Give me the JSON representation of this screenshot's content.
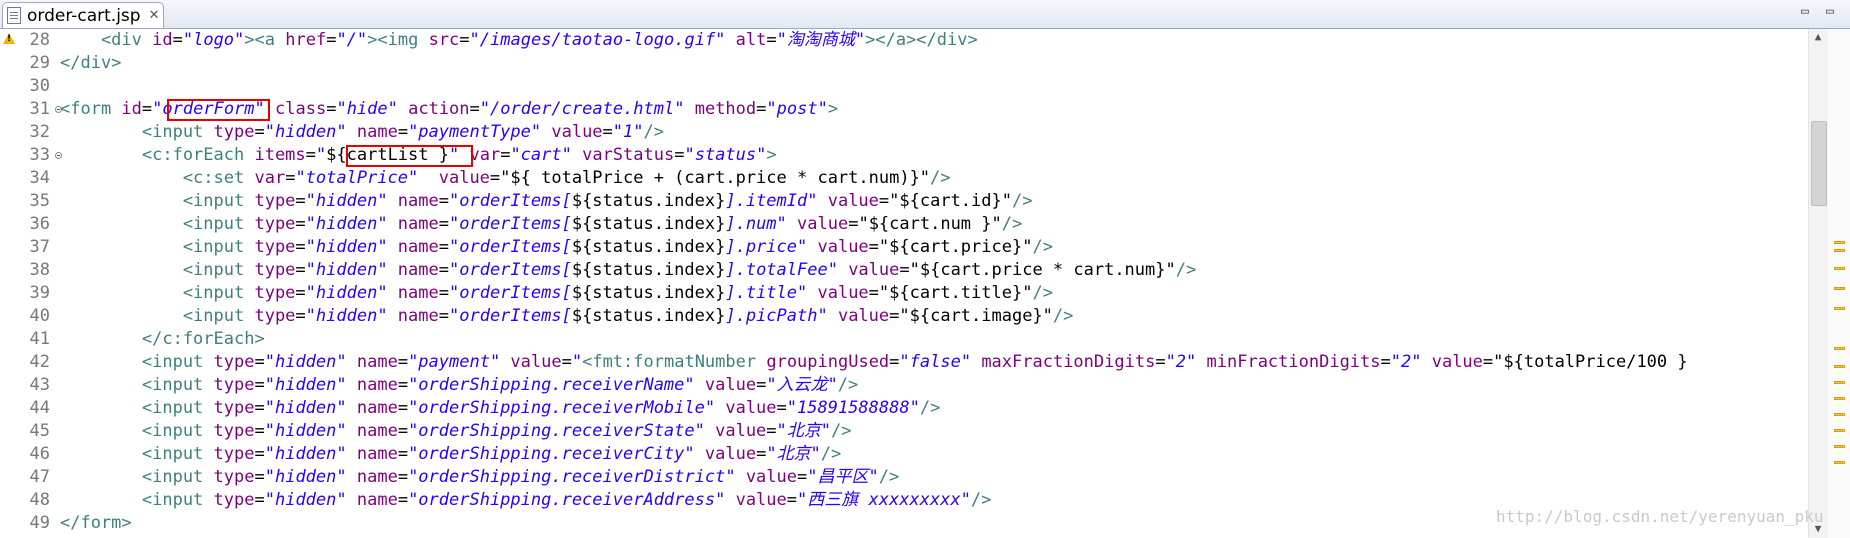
{
  "tab": {
    "filename": "order-cart.jsp",
    "close_glyph": "✕"
  },
  "window_controls": {
    "minimize": "▭",
    "maximize": "▭"
  },
  "line_numbers": [
    "28",
    "29",
    "30",
    "31",
    "32",
    "33",
    "34",
    "35",
    "36",
    "37",
    "38",
    "39",
    "40",
    "41",
    "42",
    "43",
    "44",
    "45",
    "46",
    "47",
    "48",
    "49"
  ],
  "colors": {
    "tag": "#3f7f7f",
    "attribute": "#7f007f",
    "string": "#2a00ff",
    "plain": "#000000",
    "highlight_box": "#e60000"
  },
  "code": {
    "l28": [
      "    <div ",
      "id",
      "=",
      "\"logo\"",
      "><a ",
      "href",
      "=",
      "\"/\"",
      "><img ",
      "src",
      "=",
      "\"/images/taotao-logo.gif\"",
      "alt",
      "=",
      "\"淘淘商城\"",
      "></a></div>"
    ],
    "l29": [
      "</div>"
    ],
    "l31": [
      "<form ",
      "id",
      "=",
      "\"",
      "orderForm",
      "\"",
      " class",
      "=",
      "\"hide\"",
      " action",
      "=",
      "\"/order/create.html\"",
      " method",
      "=",
      "\"post\"",
      ">"
    ],
    "l32": [
      "        <input ",
      "type",
      "=",
      "\"hidden\"",
      " name",
      "=",
      "\"paymentType\"",
      " value",
      "=",
      "\"1\"",
      "/>"
    ],
    "l33": [
      "        <c:forEach ",
      "items",
      "=",
      "\"",
      "${cartList }",
      "\"",
      " var",
      "=",
      "\"cart\"",
      " varStatus",
      "=",
      "\"status\"",
      ">"
    ],
    "l34": [
      "            <c:set ",
      "var",
      "=",
      "\"totalPrice\"",
      "  value",
      "=",
      "\"${ totalPrice + (cart.price * cart.num)}\"",
      "/>"
    ],
    "l35": [
      "            <input ",
      "type",
      "=",
      "\"hidden\"",
      " name",
      "=",
      "\"orderItems[",
      "${status.index}",
      "].itemId\"",
      " value",
      "=",
      "\"${cart.id}\"",
      "/>"
    ],
    "l36": [
      "            <input ",
      "type",
      "=",
      "\"hidden\"",
      " name",
      "=",
      "\"orderItems[",
      "${status.index}",
      "].num\"",
      " value",
      "=",
      "\"${cart.num }\"",
      "/>"
    ],
    "l37": [
      "            <input ",
      "type",
      "=",
      "\"hidden\"",
      " name",
      "=",
      "\"orderItems[",
      "${status.index}",
      "].price\"",
      " value",
      "=",
      "\"${cart.price}\"",
      "/>"
    ],
    "l38": [
      "            <input ",
      "type",
      "=",
      "\"hidden\"",
      " name",
      "=",
      "\"orderItems[",
      "${status.index}",
      "].totalFee\"",
      " value",
      "=",
      "\"${cart.price * cart.num}\"",
      "/>"
    ],
    "l39": [
      "            <input ",
      "type",
      "=",
      "\"hidden\"",
      " name",
      "=",
      "\"orderItems[",
      "${status.index}",
      "].title\"",
      " value",
      "=",
      "\"${cart.title}\"",
      "/>"
    ],
    "l40": [
      "            <input ",
      "type",
      "=",
      "\"hidden\"",
      " name",
      "=",
      "\"orderItems[",
      "${status.index}",
      "].picPath\"",
      " value",
      "=",
      "\"${cart.image}\"",
      "/>"
    ],
    "l41": [
      "        </c:forEach>"
    ],
    "l42": [
      "        <input ",
      "type",
      "=",
      "\"hidden\"",
      " name",
      "=",
      "\"payment\"",
      " value",
      "=",
      "\"",
      "<fmt:formatNumber ",
      "groupingUsed",
      "=",
      "\"false\"",
      " maxFractionDigits",
      "=",
      "\"2\"",
      " minFractionDigits",
      "=",
      "\"2\"",
      " value",
      "=",
      "\"${totalPrice/100 }"
    ],
    "l43": [
      "        <input ",
      "type",
      "=",
      "\"hidden\"",
      " name",
      "=",
      "\"orderShipping.receiverName\"",
      " value",
      "=",
      "\"入云龙\"",
      "/>"
    ],
    "l44": [
      "        <input ",
      "type",
      "=",
      "\"hidden\"",
      " name",
      "=",
      "\"orderShipping.receiverMobile\"",
      " value",
      "=",
      "\"15891588888\"",
      "/>"
    ],
    "l45": [
      "        <input ",
      "type",
      "=",
      "\"hidden\"",
      " name",
      "=",
      "\"orderShipping.receiverState\"",
      " value",
      "=",
      "\"北京\"",
      "/>"
    ],
    "l46": [
      "        <input ",
      "type",
      "=",
      "\"hidden\"",
      " name",
      "=",
      "\"orderShipping.receiverCity\"",
      " value",
      "=",
      "\"北京\"",
      "/>"
    ],
    "l47": [
      "        <input ",
      "type",
      "=",
      "\"hidden\"",
      " name",
      "=",
      "\"orderShipping.receiverDistrict\"",
      " value",
      "=",
      "\"昌平区\"",
      "/>"
    ],
    "l48": [
      "        <input ",
      "type",
      "=",
      "\"hidden\"",
      " name",
      "=",
      "\"orderShipping.receiverAddress\"",
      " value",
      "=",
      "\"西三旗 xxxxxxxxx\"",
      "/>"
    ],
    "l49": [
      "</form>"
    ]
  },
  "watermark": "http://blog.csdn.net/yerenyuan_pku"
}
